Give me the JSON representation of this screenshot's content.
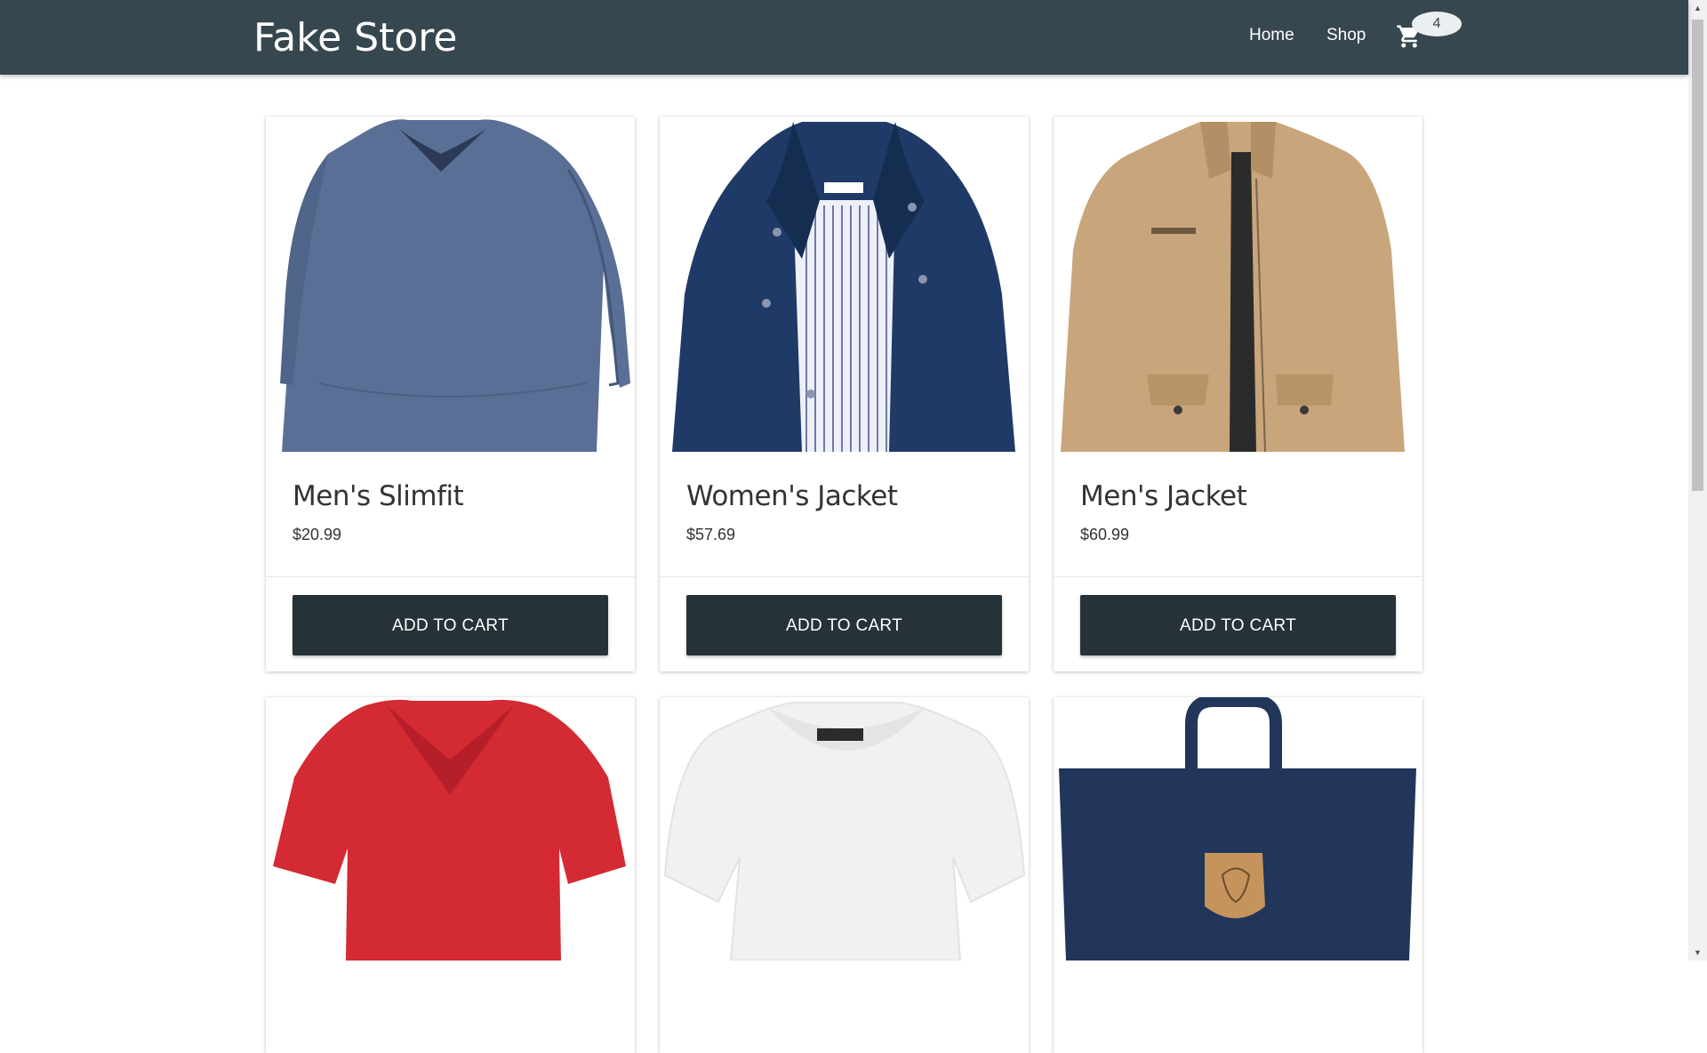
{
  "navbar": {
    "brand": "Fake Store",
    "links": [
      "Home",
      "Shop"
    ],
    "cart_count": "4",
    "cart_icon": "cart-icon"
  },
  "products": [
    {
      "title": "Men's Slimfit",
      "price": "$20.99",
      "button": "ADD TO CART",
      "image": "blue-long-sleeve-shirt"
    },
    {
      "title": "Women's Jacket",
      "price": "$57.69",
      "button": "ADD TO CART",
      "image": "navy-womens-jacket"
    },
    {
      "title": "Men's Jacket",
      "price": "$60.99",
      "button": "ADD TO CART",
      "image": "tan-mens-jacket"
    },
    {
      "image": "red-v-neck-tshirt"
    },
    {
      "image": "white-womens-top"
    },
    {
      "image": "navy-backpack"
    }
  ],
  "colors": {
    "navbar": "#37474f",
    "button": "#263238",
    "badge": "#eceff1"
  }
}
